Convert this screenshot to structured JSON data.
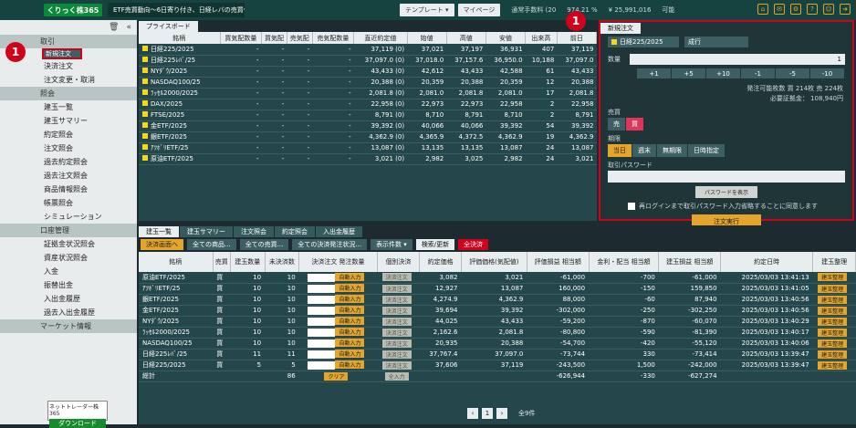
{
  "logo": "くりっく株365",
  "ticker": "ETF売買動向～6日寄り付き、日経レバの売買代金…",
  "top_buttons": [
    "テンプレート ▾",
    "マイページ"
  ],
  "top_info": [
    "通常手数料 (20",
    "974.21 %",
    "¥ 25,991,016",
    "可能"
  ],
  "sidebar": {
    "sections": [
      {
        "title": "取引",
        "items": [
          "新規注文",
          "決済注文",
          "注文変更・取消"
        ]
      },
      {
        "title": "照会",
        "items": [
          "建玉一覧",
          "建玉サマリー",
          "約定照会",
          "注文照会",
          "過去約定照会",
          "過去注文照会",
          "商品情報照会",
          "帳票照会",
          "シミュレーション"
        ]
      },
      {
        "title": "口座管理",
        "items": [
          "証拠金状況照会",
          "資産状況照会",
          "入金",
          "振替出金",
          "入出金履歴",
          "過去入出金履歴"
        ]
      },
      {
        "title": "マーケット情報",
        "items": []
      }
    ],
    "download_title": "ネットトレーダー株365",
    "download_label": "ダウンロード"
  },
  "badge": "1",
  "board": {
    "tab": "プライスボード",
    "headers": [
      "銘柄",
      "買気配数量",
      "買気配",
      "売気配",
      "売気配数量",
      "直近約定値",
      "始値",
      "高値",
      "安値",
      "出来高",
      "前日"
    ],
    "rows": [
      [
        "日経225/2025",
        "-",
        "-",
        "-",
        "-",
        "37,119 (0)",
        "37,021",
        "37,197",
        "36,931",
        "407",
        "37,119"
      ],
      [
        "日経225ﾚﾊﾞ/25",
        "-",
        "-",
        "-",
        "-",
        "37,097.0 (0)",
        "37,018.0",
        "37,157.6",
        "36,950.0",
        "10,188",
        "37,097.0"
      ],
      [
        "NYﾀﾞｳ/2025",
        "-",
        "-",
        "-",
        "-",
        "43,433 (0)",
        "42,612",
        "43,433",
        "42,588",
        "61",
        "43,433"
      ],
      [
        "NASDAQ100/25",
        "-",
        "-",
        "-",
        "-",
        "20,388 (0)",
        "20,359",
        "20,388",
        "20,359",
        "12",
        "20,388"
      ],
      [
        "ﾗｯｾﾙ2000/2025",
        "-",
        "-",
        "-",
        "-",
        "2,081.8 (0)",
        "2,081.0",
        "2,081.8",
        "2,081.0",
        "17",
        "2,081.8"
      ],
      [
        "DAX/2025",
        "-",
        "-",
        "-",
        "-",
        "22,958 (0)",
        "22,973",
        "22,973",
        "22,958",
        "2",
        "22,958"
      ],
      [
        "FTSE/2025",
        "-",
        "-",
        "-",
        "-",
        "8,791 (0)",
        "8,710",
        "8,791",
        "8,710",
        "2",
        "8,791"
      ],
      [
        "金ETF/2025",
        "-",
        "-",
        "-",
        "-",
        "39,392 (0)",
        "40,066",
        "40,066",
        "39,392",
        "54",
        "39,392"
      ],
      [
        "銀ETF/2025",
        "-",
        "-",
        "-",
        "-",
        "4,362.9 (0)",
        "4,365.9",
        "4,372.5",
        "4,362.9",
        "19",
        "4,362.9"
      ],
      [
        "ｱﾂﾎﾞﾘETF/25",
        "-",
        "-",
        "-",
        "-",
        "13,087 (0)",
        "13,135",
        "13,135",
        "13,087",
        "24",
        "13,087"
      ],
      [
        "原油ETF/2025",
        "-",
        "-",
        "-",
        "-",
        "3,021 (0)",
        "2,982",
        "3,025",
        "2,982",
        "24",
        "3,021"
      ]
    ]
  },
  "order": {
    "tab": "新規注文",
    "symbol": "日経225/2025",
    "type": "成行",
    "qty_label": "数量",
    "qty": "1",
    "steps": [
      "+1",
      "+5",
      "+10",
      "-1",
      "-5",
      "-10"
    ],
    "avail": "発注可能枚数 買 214枚 売 224枚",
    "margin": "必要証拠金： 108,940円",
    "side_label": "売買",
    "sell": "売",
    "buy": "買",
    "period_label": "期限",
    "periods": [
      "当日",
      "週末",
      "無期限",
      "日時指定"
    ],
    "pw_label": "取引パスワード",
    "show_pw": "パスワードを表示",
    "check": "再ログインまで取引パスワード入力省略することに同意します",
    "submit": "注文実行"
  },
  "positions": {
    "tabs": [
      "建玉一覧",
      "建玉サマリー",
      "注文照会",
      "約定照会",
      "入出金履歴"
    ],
    "controls": [
      "決済画面へ",
      "全ての商品...",
      "全ての売買...",
      "全ての決済発注状況...",
      "表示件数 ▾",
      "検索/更新",
      "全決済"
    ],
    "headers": [
      "銘柄",
      "売買",
      "建玉数量",
      "未決済数",
      "決済注文 発注数量",
      "個別決済",
      "約定価格",
      "評価価格(気配値)",
      "評価損益 相当額",
      "金利・配当 相当額",
      "建玉損益 相当額",
      "約定日時",
      "建玉整理"
    ],
    "rows": [
      [
        "原油ETF/2025",
        "買",
        "10",
        "10",
        "自動入力",
        "決済注文",
        "3,082",
        "3,021",
        "-61,000",
        "-700",
        "-61,000",
        "2025/03/03 13:41:13",
        "建玉整理"
      ],
      [
        "ｱﾂﾎﾞﾘETF/25",
        "買",
        "10",
        "10",
        "自動入力",
        "決済注文",
        "12,927",
        "13,087",
        "160,000",
        "-150",
        "159,850",
        "2025/03/03 13:41:05",
        "建玉整理"
      ],
      [
        "銀ETF/2025",
        "買",
        "10",
        "10",
        "自動入力",
        "決済注文",
        "4,274.9",
        "4,362.9",
        "88,000",
        "-60",
        "87,940",
        "2025/03/03 13:40:56",
        "建玉整理"
      ],
      [
        "金ETF/2025",
        "買",
        "10",
        "10",
        "自動入力",
        "決済注文",
        "39,694",
        "39,392",
        "-302,000",
        "-250",
        "-302,250",
        "2025/03/03 13:40:56",
        "建玉整理"
      ],
      [
        "NYﾀﾞｳ/2025",
        "買",
        "10",
        "10",
        "自動入力",
        "決済注文",
        "44,025",
        "43,433",
        "-59,200",
        "-870",
        "-60,070",
        "2025/03/03 13:40:29",
        "建玉整理"
      ],
      [
        "ﾗｯｾﾙ2000/2025",
        "買",
        "10",
        "10",
        "自動入力",
        "決済注文",
        "2,162.6",
        "2,081.8",
        "-80,800",
        "-590",
        "-81,390",
        "2025/03/03 13:40:17",
        "建玉整理"
      ],
      [
        "NASDAQ100/25",
        "買",
        "10",
        "10",
        "自動入力",
        "決済注文",
        "20,935",
        "20,388",
        "-54,700",
        "-420",
        "-55,120",
        "2025/03/03 13:40:06",
        "建玉整理"
      ],
      [
        "日経225ﾚﾊﾞ/25",
        "買",
        "11",
        "11",
        "自動入力",
        "決済注文",
        "37,767.4",
        "37,097.0",
        "-73,744",
        "330",
        "-73,414",
        "2025/03/03 13:39:47",
        "建玉整理"
      ],
      [
        "日経225/2025",
        "買",
        "5",
        "5",
        "自動入力",
        "決済注文",
        "37,606",
        "37,119",
        "-243,500",
        "1,500",
        "-242,000",
        "2025/03/03 13:39:47",
        "建玉整理"
      ]
    ],
    "total_label": "総計",
    "total_qty": "86",
    "clear": "クリア",
    "all_in": "全入力",
    "total_pl": "-626,944",
    "total_int": "-330",
    "total_pos": "-627,274",
    "page": "1",
    "count": "全9件"
  }
}
